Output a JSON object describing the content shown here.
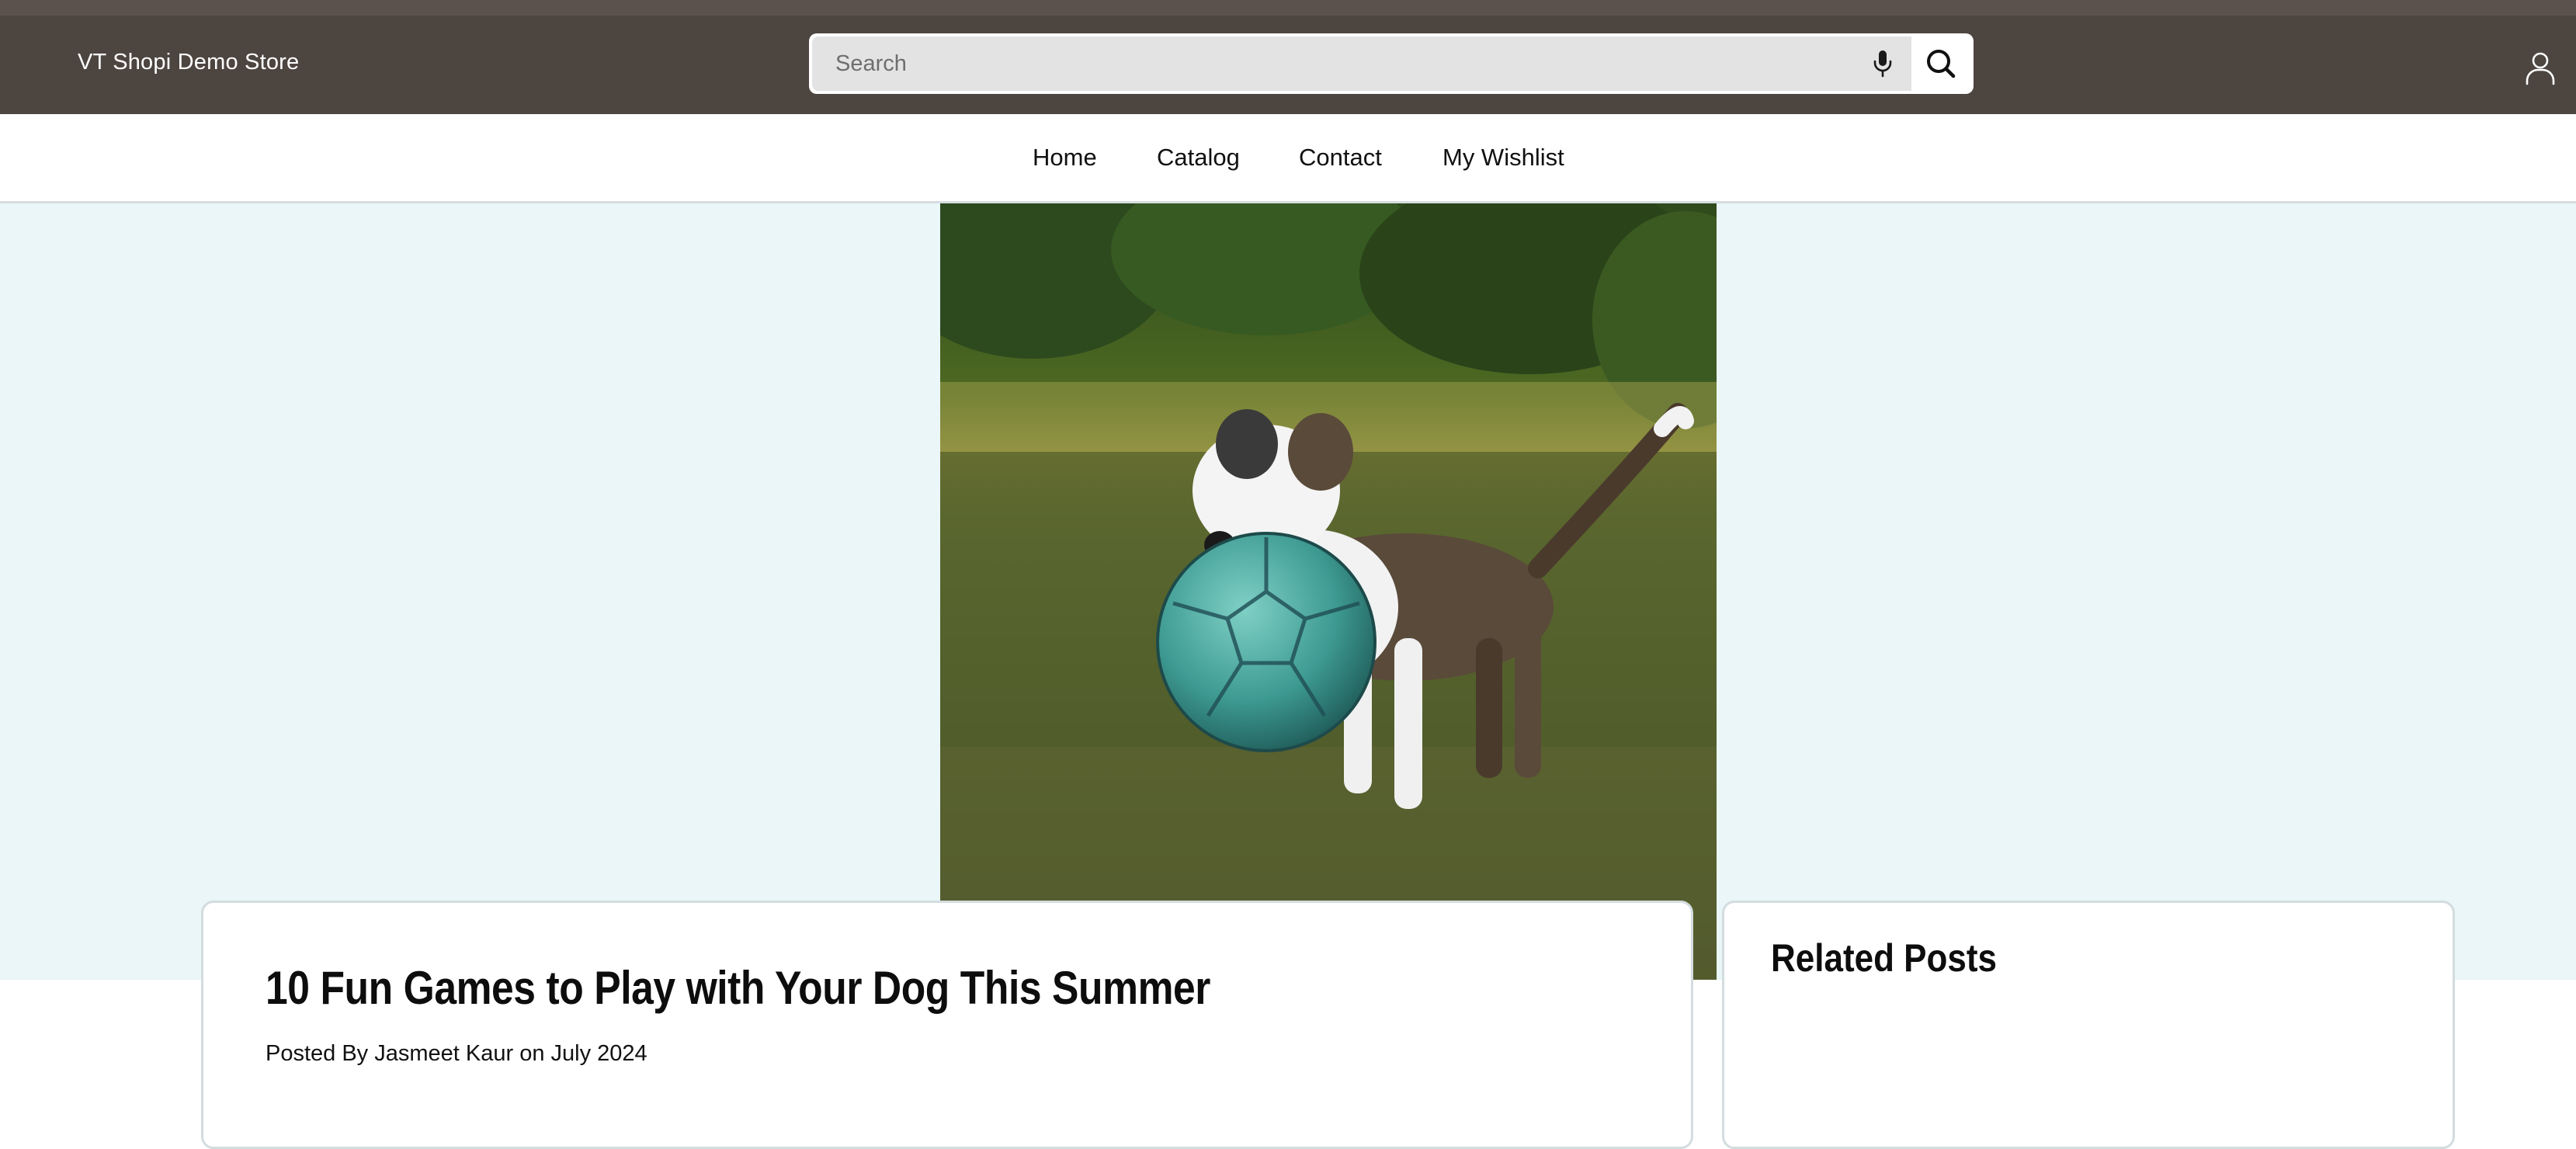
{
  "header": {
    "brand": "VT Shopi Demo Store",
    "search": {
      "placeholder": "Search",
      "value": ""
    },
    "icons": {
      "mic": "microphone-icon",
      "search": "search-icon",
      "account": "user-icon"
    }
  },
  "nav": {
    "items": [
      {
        "label": "Home"
      },
      {
        "label": "Catalog"
      },
      {
        "label": "Contact"
      },
      {
        "label": "My Wishlist"
      }
    ]
  },
  "hero": {
    "image_alt": "Dog carrying a teal soccer ball on grass"
  },
  "article": {
    "title": "10 Fun Games to Play with Your Dog This Summer",
    "meta": "Posted By Jasmeet Kaur on July 2024"
  },
  "sidebar": {
    "related_title": "Related Posts"
  },
  "colors": {
    "header_bg": "#4d4540",
    "header_strip": "#5b524d",
    "hero_band": "#eaf6f7",
    "card_border": "#d3dcdf"
  }
}
